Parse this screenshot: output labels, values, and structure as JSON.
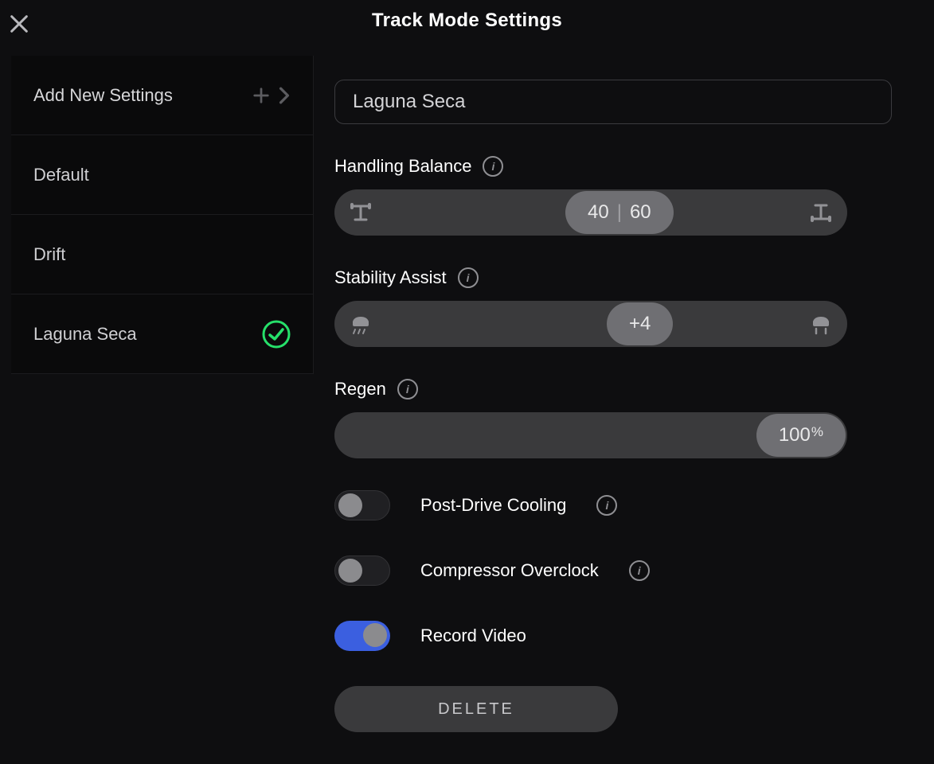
{
  "title": "Track Mode Settings",
  "sidebar": {
    "add_label": "Add New Settings",
    "items": [
      {
        "label": "Default",
        "selected": false
      },
      {
        "label": "Drift",
        "selected": false
      },
      {
        "label": "Laguna Seca",
        "selected": true
      }
    ]
  },
  "main": {
    "name_value": "Laguna Seca",
    "handling_balance": {
      "label": "Handling Balance",
      "front": "40",
      "rear": "60"
    },
    "stability_assist": {
      "label": "Stability Assist",
      "value": "+4"
    },
    "regen": {
      "label": "Regen",
      "value": "100",
      "unit": "%"
    },
    "toggles": {
      "post_drive_cooling": {
        "label": "Post-Drive Cooling",
        "on": false,
        "has_info": true
      },
      "compressor_overclock": {
        "label": "Compressor Overclock",
        "on": false,
        "has_info": true
      },
      "record_video": {
        "label": "Record Video",
        "on": true,
        "has_info": false
      }
    },
    "delete_label": "DELETE"
  },
  "colors": {
    "accent_green": "#26E06A",
    "accent_blue": "#3B5FE0"
  }
}
